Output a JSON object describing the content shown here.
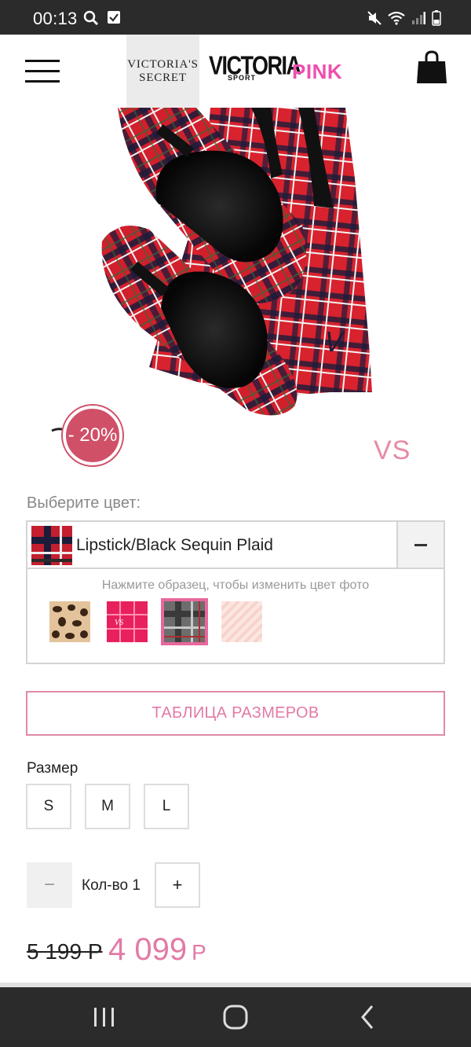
{
  "status_bar": {
    "time": "00:13",
    "icons": [
      "search-icon",
      "checkbox-notification-icon",
      "mute-icon",
      "wifi-icon",
      "signal-icon",
      "battery-icon"
    ]
  },
  "header": {
    "brands": [
      {
        "label_line1": "Victoria's",
        "label_line2": "Secret",
        "selected": true
      },
      {
        "label": "VICTORIA",
        "sublabel": "SPORT"
      },
      {
        "label": "PINK",
        "color": "#f04eae"
      }
    ],
    "menu_icon": "hamburger-icon",
    "cart_icon": "shopping-bag-icon"
  },
  "product": {
    "discount_badge": "- 20%",
    "watermark": "VS",
    "accent_color": "#e27aa6"
  },
  "color": {
    "label": "Выберите цвет:",
    "selected_name": "Lipstick/Black Sequin Plaid",
    "hint": "Нажмите образец, чтобы изменить цвет фото",
    "swatches": [
      "leopard",
      "pink-logo",
      "grey-plaid",
      "blush-stripe"
    ],
    "selected_swatch": "grey-plaid"
  },
  "size_chart_label": "ТАБЛИЦА РАЗМЕРОВ",
  "size": {
    "label": "Размер",
    "options": [
      "S",
      "M",
      "L"
    ]
  },
  "quantity": {
    "minus": "−",
    "label": "Кол-во 1",
    "plus": "+"
  },
  "price": {
    "old": "5 199 Р",
    "new": "4 099",
    "currency": "Р"
  },
  "nav_bar": {
    "icons": [
      "recent-apps-icon",
      "home-icon",
      "back-icon"
    ]
  }
}
